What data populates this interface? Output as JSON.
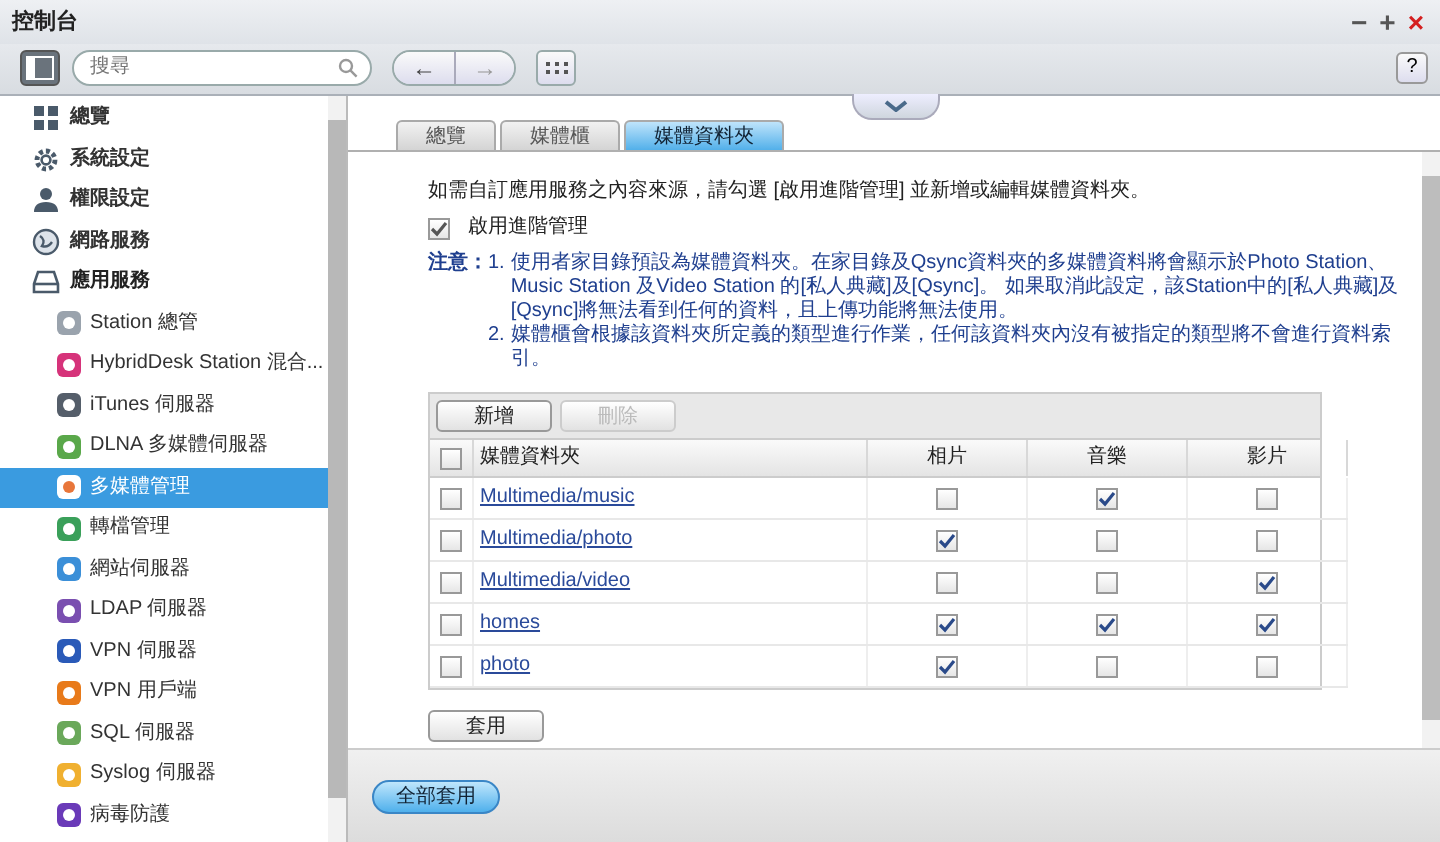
{
  "window": {
    "title": "控制台"
  },
  "toolbar": {
    "search": {
      "placeholder": "搜尋"
    },
    "back_label": "←",
    "forward_label": "→",
    "help_label": "?"
  },
  "window_controls": [
    "−",
    "+",
    "×"
  ],
  "sidebar": {
    "items": [
      {
        "label": "總覽",
        "selected": false
      },
      {
        "label": "系統設定",
        "selected": false
      },
      {
        "label": "權限設定",
        "selected": false
      },
      {
        "label": "網路服務",
        "selected": false
      },
      {
        "label": "應用服務",
        "selected": false,
        "expanded": true,
        "children": [
          {
            "label": "Station 總管",
            "selected": false
          },
          {
            "label": "HybridDesk Station 混合...",
            "selected": false
          },
          {
            "label": "iTunes 伺服器",
            "selected": false
          },
          {
            "label": "DLNA 多媒體伺服器",
            "selected": false
          },
          {
            "label": "多媒體管理",
            "selected": true
          },
          {
            "label": "轉檔管理",
            "selected": false
          },
          {
            "label": "網站伺服器",
            "selected": false
          },
          {
            "label": "LDAP 伺服器",
            "selected": false
          },
          {
            "label": "VPN 伺服器",
            "selected": false
          },
          {
            "label": "VPN 用戶端",
            "selected": false
          },
          {
            "label": "SQL 伺服器",
            "selected": false
          },
          {
            "label": "Syslog 伺服器",
            "selected": false
          },
          {
            "label": "病毒防護",
            "selected": false
          }
        ]
      }
    ]
  },
  "tabs": [
    {
      "label": "總覽",
      "selected": false
    },
    {
      "label": "媒體櫃",
      "selected": false
    },
    {
      "label": "媒體資料夾",
      "selected": true
    }
  ],
  "intro": "如需自訂應用服務之內容來源，請勾選 [啟用進階管理] 並新增或編輯媒體資料夾。",
  "advanced_management": {
    "label": "啟用進階管理",
    "checked": true
  },
  "notes": {
    "label": "注意：",
    "items": [
      {
        "number": "1.",
        "text": "使用者家目錄預設為媒體資料夾。在家目錄及Qsync資料夾的多媒體資料將會顯示於Photo Station、Music Station 及Video Station 的[私人典藏]及[Qsync]。 如果取消此設定，該Station中的[私人典藏]及[Qsync]將無法看到任何的資料，且上傳功能將無法使用。"
      },
      {
        "number": "2.",
        "text": "媒體櫃會根據該資料夾所定義的類型進行作業，任何該資料夾內沒有被指定的類型將不會進行資料索引。"
      }
    ]
  },
  "table_buttons": [
    {
      "label": "新增",
      "disabled": false
    },
    {
      "label": "刪除",
      "disabled": true
    }
  ],
  "table": {
    "select_all_checked": false,
    "columns": [
      "媒體資料夾",
      "相片",
      "音樂",
      "影片"
    ],
    "rows": [
      {
        "folder": "Multimedia/music",
        "selected": false,
        "photo": false,
        "music": true,
        "video": false
      },
      {
        "folder": "Multimedia/photo",
        "selected": false,
        "photo": true,
        "music": false,
        "video": false
      },
      {
        "folder": "Multimedia/video",
        "selected": false,
        "photo": false,
        "music": false,
        "video": true
      },
      {
        "folder": "homes",
        "selected": false,
        "photo": true,
        "music": true,
        "video": true
      },
      {
        "folder": "photo",
        "selected": false,
        "photo": true,
        "music": false,
        "video": false
      }
    ]
  },
  "apply_button": "套用",
  "apply_all_button": "全部套用"
}
